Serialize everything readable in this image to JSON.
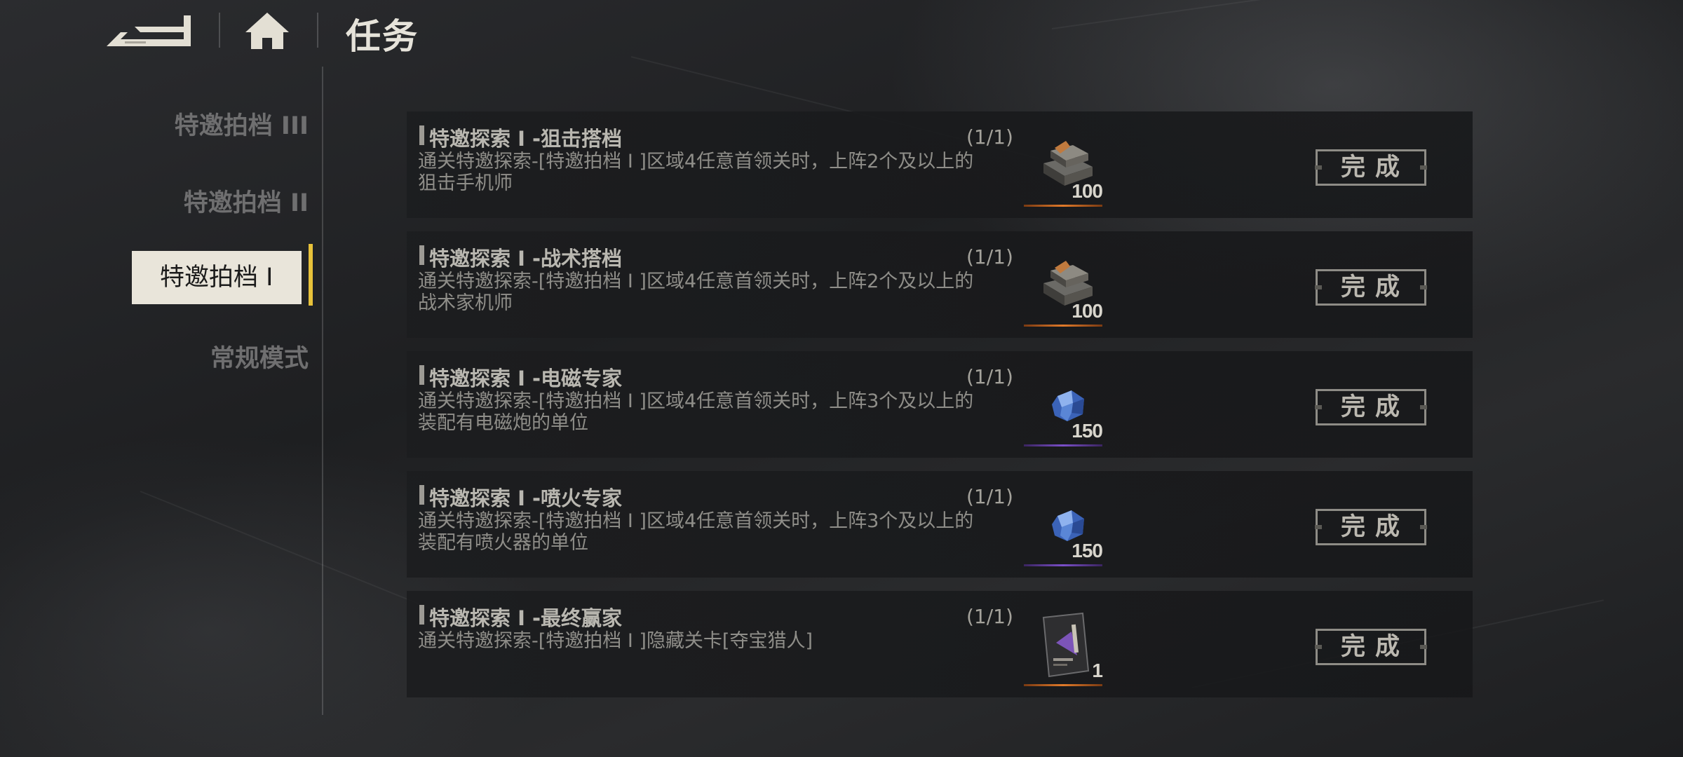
{
  "header": {
    "title": "任务",
    "back_icon": "back-arrow-icon",
    "home_icon": "home-icon"
  },
  "sidebar": {
    "items": [
      {
        "label": "特邀拍档 III",
        "active": false
      },
      {
        "label": "特邀拍档 II",
        "active": false
      },
      {
        "label": "特邀拍档 I",
        "active": true
      },
      {
        "label": "常规模式",
        "active": false
      }
    ],
    "accent_color": "#e8c23a"
  },
  "tasks": [
    {
      "title": "特邀探索 I -狙击搭档",
      "progress": "(1/1)",
      "desc_line1": "通关特邀探索-[特邀拍档 I ]区域4任意首领关时，上阵2个及以上的",
      "desc_line2": "狙击手机师",
      "reward": {
        "icon": "metal-ingot-icon",
        "count": "100",
        "color": "#c8641e"
      },
      "button": "完成"
    },
    {
      "title": "特邀探索 I -战术搭档",
      "progress": "(1/1)",
      "desc_line1": "通关特邀探索-[特邀拍档 I ]区域4任意首领关时，上阵2个及以上的",
      "desc_line2": "战术家机师",
      "reward": {
        "icon": "metal-ingot-icon",
        "count": "100",
        "color": "#c8641e"
      },
      "button": "完成"
    },
    {
      "title": "特邀探索 I -电磁专家",
      "progress": "(1/1)",
      "desc_line1": "通关特邀探索-[特邀拍档 I ]区域4任意首领关时，上阵3个及以上的",
      "desc_line2": "装配有电磁炮的单位",
      "reward": {
        "icon": "blue-crystal-icon",
        "count": "150",
        "color": "#6a3fb0"
      },
      "button": "完成"
    },
    {
      "title": "特邀探索 I -喷火专家",
      "progress": "(1/1)",
      "desc_line1": "通关特邀探索-[特邀拍档 I ]区域4任意首领关时，上阵3个及以上的",
      "desc_line2": "装配有喷火器的单位",
      "reward": {
        "icon": "blue-crystal-icon",
        "count": "150",
        "color": "#6a3fb0"
      },
      "button": "完成"
    },
    {
      "title": "特邀探索 I -最终赢家",
      "progress": "(1/1)",
      "desc_line1": "通关特邀探索-[特邀拍档 I ]隐藏关卡[夺宝猎人]",
      "desc_line2": "",
      "reward": {
        "icon": "card-pack-icon",
        "count": "1",
        "color": "#c8641e"
      },
      "button": "完成"
    }
  ]
}
